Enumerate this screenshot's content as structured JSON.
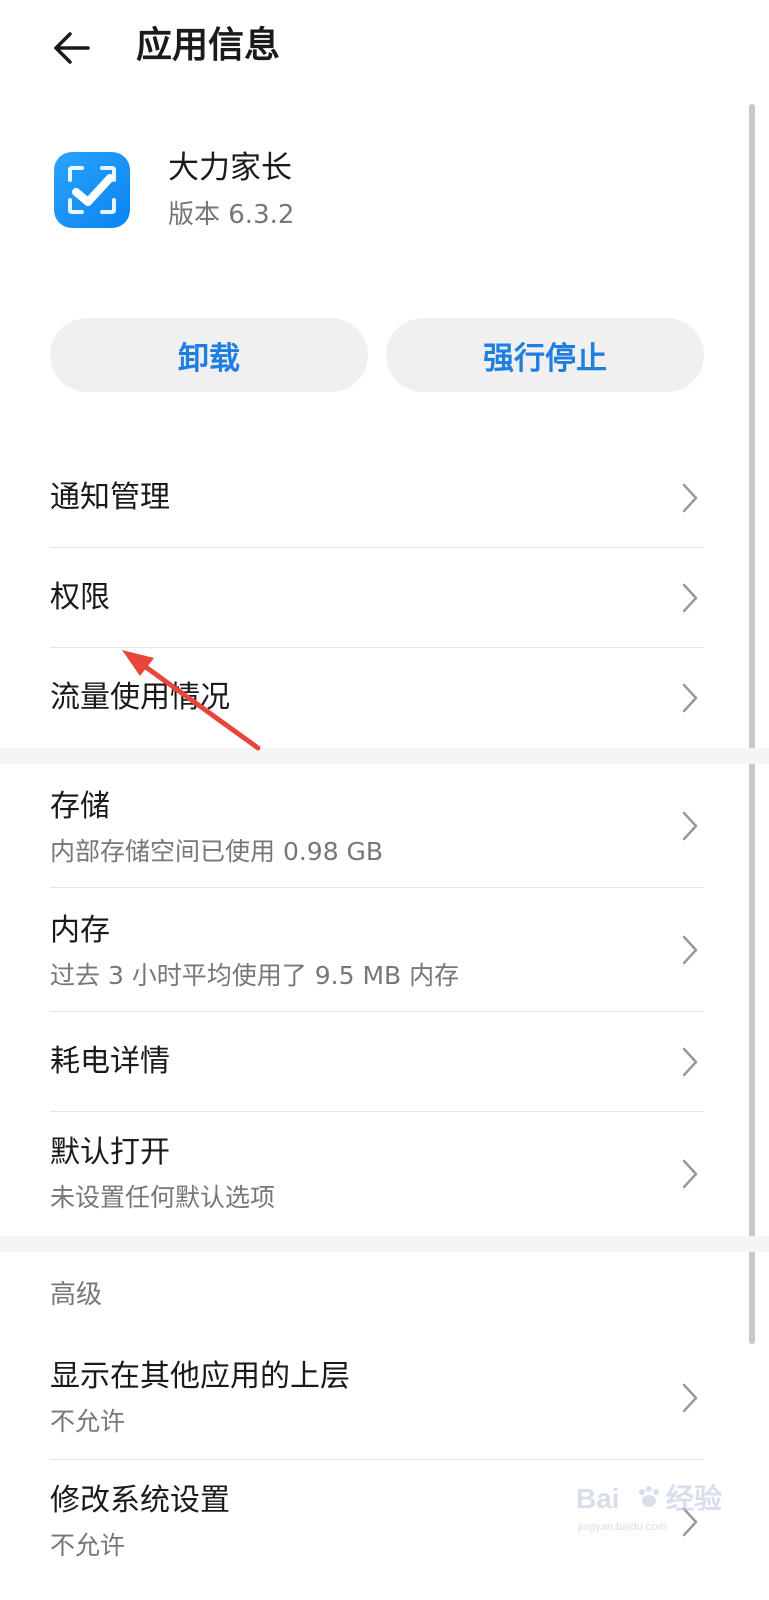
{
  "header": {
    "title": "应用信息",
    "back_icon": "arrow-left-icon"
  },
  "app": {
    "name": "大力家长",
    "version": "版本 6.3.2",
    "icon": "checkmark-app-icon",
    "icon_color": "#1a8ff5"
  },
  "actions": {
    "uninstall": "卸载",
    "force_stop": "强行停止",
    "accent_color": "#1f7fe0"
  },
  "items": [
    {
      "label": "通知管理"
    },
    {
      "label": "权限"
    },
    {
      "label": "流量使用情况"
    },
    {
      "label": "存储",
      "sub": "内部存储空间已使用 0.98 GB"
    },
    {
      "label": "内存",
      "sub": "过去 3 小时平均使用了 9.5 MB 内存"
    },
    {
      "label": "耗电详情"
    },
    {
      "label": "默认打开",
      "sub": "未设置任何默认选项"
    },
    {
      "label": "显示在其他应用的上层",
      "sub": "不允许"
    },
    {
      "label": "修改系统设置",
      "sub": "不允许"
    }
  ],
  "sections": {
    "advanced": "高级"
  },
  "watermark": {
    "brand": "Bai",
    "brand_suffix": "经验",
    "site": "jingyan.baidu.com"
  },
  "annotation": {
    "arrow_color": "#e8463c"
  }
}
